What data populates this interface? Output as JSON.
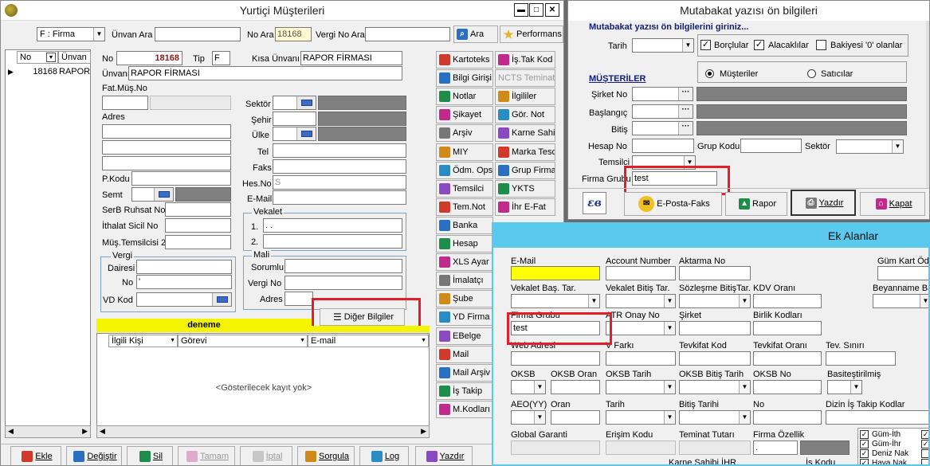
{
  "main": {
    "title": "Yurtiçi Müşterileri",
    "search": {
      "type_value": "F : Firma",
      "unvan_label": "Ünvan Ara",
      "no_label": "No Ara",
      "no_value": "18168",
      "vergi_label": "Vergi No Ara",
      "ara_label": "Ara",
      "perf_label": "Performans"
    },
    "list": {
      "col_no": "No",
      "col_unvan": "Ünvan",
      "row_no": "18168",
      "row_unvan": "RAPOR"
    },
    "form": {
      "no_label": "No",
      "no_value": "18168",
      "tip_label": "Tip",
      "tip_value": "F",
      "kisa_label": "Kısa Ünvanı",
      "kisa_value": "RAPOR FİRMASI",
      "unvan_label": "Ünvanı",
      "unvan_value": "RAPOR FİRMASI",
      "fatmus_label": "Fat.Müş.No",
      "adres_label": "Adres",
      "sektor_label": "Sektör",
      "sehir_label": "Şehir",
      "ulke_label": "Ülke",
      "tel_label": "Tel",
      "faks_label": "Faks",
      "hesno_label": "Hes.No",
      "hesno_value": "S",
      "email_label": "E-Mail",
      "pkodu_label": "P.Kodu",
      "semt_label": "Semt",
      "serb_label": "SerB Ruhsat No",
      "ithalat_label": "İthalat Sicil No",
      "mustem_label": "Müş.Temsilcisi 2",
      "vekalet_label": "Vekalet",
      "vekalet1_label": "1.",
      "vekalet1_value": ". .",
      "vekalet2_label": "2.",
      "vergi_group": "Vergi",
      "dairesi_label": "Dairesi",
      "vno_label": "No",
      "vno_value": "'",
      "vdkod_label": "VD Kod",
      "mali_group": "Mali",
      "sorumlu_label": "Sorumlu",
      "malivno_label": "Vergi No",
      "maliadres_label": "Adres",
      "diger_label": "Diğer Bilgiler"
    },
    "banner": "deneme",
    "contacts": {
      "col1": "İlgili Kişi",
      "col2": "Görevi",
      "col3": "E-mail",
      "empty": "<Gösterilecek kayıt yok>"
    },
    "side_left": [
      "Kartoteks",
      "Bilgi Girişi",
      "Notlar",
      "Şikayet",
      "Arşiv",
      "MIY",
      "Ödm. Ops.",
      "Temsilci",
      "Tem.Not",
      "Banka",
      "Hesap",
      "XLS Ayar",
      "İmalatçı",
      "Şube",
      "YD Firma",
      "EBelge",
      "Mail",
      "Mail Arşiv",
      "İş Takip",
      "M.Kodları"
    ],
    "side_right": [
      "İş.Tak Kod",
      "NCTS Teminat",
      "İlgililer",
      "Gör. Not",
      "Karne Sahibi",
      "Marka Tescil",
      "Grup Firma",
      "YKTS",
      "İhr E-Fat"
    ],
    "bottom": [
      "Ekle",
      "Değiştir",
      "Sil",
      "Tamam",
      "İptal",
      "Sorgula",
      "Log",
      "Yazdır"
    ]
  },
  "mutabakat": {
    "title": "Mutabakat yazısı ön bilgileri",
    "subtitle": "Mutabakat yazısı ön bilgilerini  giriniz...",
    "tarih_label": "Tarih",
    "borclular": "Borçlular",
    "alacaklilar": "Alacaklılar",
    "bakiyesi": "Bakiyesi '0' olanlar",
    "musteriler_head": "MÜŞTERİLER",
    "radio_musteriler": "Müşteriler",
    "radio_saticilar": "Satıcılar",
    "sirket_label": "Şirket No",
    "baslangic_label": "Başlangıç",
    "bitis_label": "Bitiş",
    "hesap_label": "Hesap No",
    "grup_label": "Grup Kodu",
    "sektor_label": "Sektör",
    "temsilci_label": "Temsilci",
    "firma_grup_label": "Firma Grubu",
    "firma_grup_value": "test",
    "eposta_label": "E-Posta-Faks",
    "rapor_label": "Rapor",
    "yazdir_label": "Yazdır",
    "kapat_label": "Kapat"
  },
  "ek": {
    "title": "Ek Alanlar",
    "email": "E-Mail",
    "account": "Account Number",
    "aktarma": "Aktarma No",
    "gumkart": "Güm Kart Öde",
    "vek_bas": "Vekalet Baş. Tar.",
    "vek_bit": "Vekalet Bitiş Tar.",
    "soz_bit": "Sözleşme BitişTar.",
    "kdv": "KDV Oranı",
    "beyanname": "Beyanname Ba",
    "firma_grubu": "Firma Grubu",
    "firma_grubu_value": "test",
    "atr": "ATR Onay No",
    "sirket": "Şirket",
    "birlik": "Birlik Kodları",
    "web": "Web Adresi",
    "vfarki": "V Farkı",
    "tevkod": "Tevkifat Kod",
    "tevoran": "Tevkifat Oranı",
    "tevsinir": "Tev. Sınırı",
    "oksb": "OKSB",
    "oksb_oran": "OKSB Oran",
    "oksb_tarih": "OKSB Tarih",
    "oksb_bitis": "OKSB Bitiş Tarih",
    "oksb_no": "OKSB No",
    "basit": "Basiteştirilmiş",
    "aeo": "AEO(YY)",
    "oran": "Oran",
    "tarih": "Tarih",
    "bitis_tarihi": "Bitiş Tarihi",
    "no": "No",
    "dizin": "Dizin İş Takip Kodlar",
    "global": "Global Garanti",
    "erisim": "Erişim Kodu",
    "teminat": "Teminat Tutarı",
    "firma_ozellik": "Firma Özellik",
    "firma_ozellik_value": ".",
    "karne": "Karne Sahibi İHR.",
    "iskodu": "İş Kodu",
    "checks": [
      "Güm-İth",
      "Güm-İhr",
      "Deniz Nak",
      "Hava Nak"
    ]
  }
}
